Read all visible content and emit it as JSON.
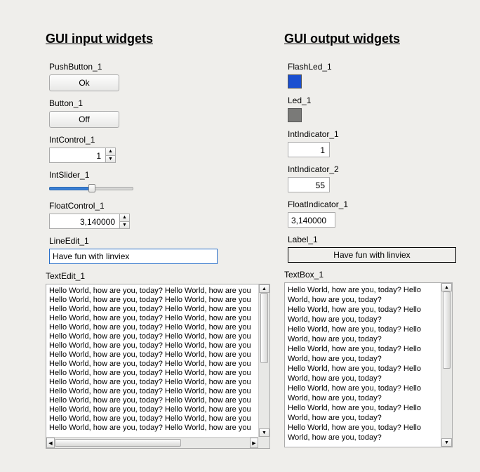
{
  "left": {
    "title": "GUI input widgets",
    "pushbutton": {
      "label": "PushButton_1",
      "text": "Ok"
    },
    "button": {
      "label": "Button_1",
      "text": "Off"
    },
    "intcontrol": {
      "label": "IntControl_1",
      "value": "1"
    },
    "intslider": {
      "label": "IntSlider_1"
    },
    "floatcontrol": {
      "label": "FloatControl_1",
      "value": "3,140000"
    },
    "lineedit": {
      "label": "LineEdit_1",
      "value": "Have fun with linviex"
    },
    "textedit": {
      "label": "TextEdit_1",
      "lines": [
        "Hello World, how are you, today? Hello World, how are you",
        "Hello World, how are you, today? Hello World, how are you",
        "Hello World, how are you, today? Hello World, how are you",
        "Hello World, how are you, today? Hello World, how are you",
        "Hello World, how are you, today? Hello World, how are you",
        "Hello World, how are you, today? Hello World, how are you",
        "Hello World, how are you, today? Hello World, how are you",
        "Hello World, how are you, today? Hello World, how are you",
        "Hello World, how are you, today? Hello World, how are you",
        "Hello World, how are you, today? Hello World, how are you",
        "Hello World, how are you, today? Hello World, how are you",
        "Hello World, how are you, today? Hello World, how are you",
        "Hello World, how are you, today? Hello World, how are you",
        "Hello World, how are you, today? Hello World, how are you",
        "Hello World, how are you, today? Hello World, how are you",
        "Hello World, how are you, today? Hello World, how are you"
      ]
    }
  },
  "right": {
    "title": "GUI output widgets",
    "flashled": {
      "label": "FlashLed_1",
      "color": "#1a4fd0"
    },
    "led": {
      "label": "Led_1",
      "color": "#7a7a78"
    },
    "intindicator1": {
      "label": "IntIndicator_1",
      "value": "1"
    },
    "intindicator2": {
      "label": "IntIndicator_2",
      "value": "55"
    },
    "floatindicator": {
      "label": "FloatIndicator_1",
      "value": "3,140000"
    },
    "label": {
      "label": "Label_1",
      "text": "Have fun with linviex"
    },
    "textbox": {
      "label": "TextBox_1",
      "lines": [
        "Hello World, how are you, today? Hello World, how are you, today?",
        "Hello World, how are you, today? Hello World, how are you, today?",
        "Hello World, how are you, today? Hello World, how are you, today?",
        "Hello World, how are you, today? Hello World, how are you, today?",
        "Hello World, how are you, today? Hello World, how are you, today?",
        "Hello World, how are you, today? Hello World, how are you, today?",
        "Hello World, how are you, today? Hello World, how are you, today?",
        "Hello World, how are you, today? Hello World, how are you, today?"
      ]
    }
  }
}
